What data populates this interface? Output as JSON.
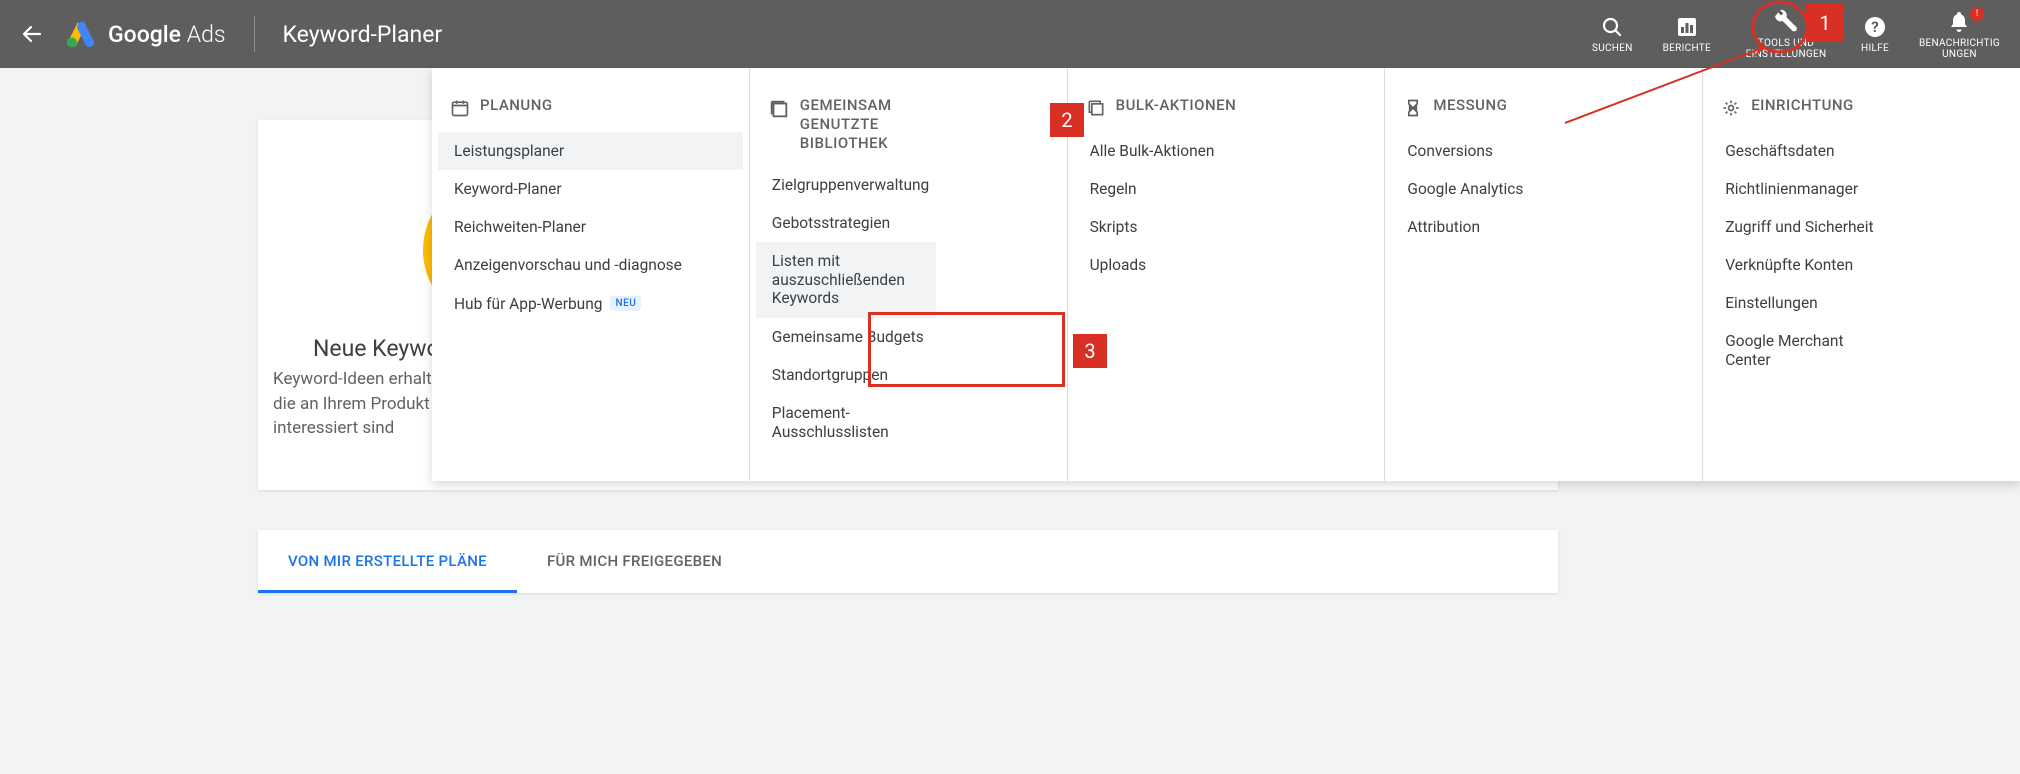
{
  "header": {
    "brand_bold": "Google",
    "brand_light": "Ads",
    "page_title": "Keyword-Planer",
    "tools": {
      "search": "SUCHEN",
      "reports": "BERICHTE",
      "tools_settings": "TOOLS UND EINSTELLUNGEN",
      "help": "HILFE",
      "notifications": "BENACHRICHTIG\nUNGEN"
    }
  },
  "card": {
    "title": "Neue Keywo",
    "description": "Keyword-Ideen erhalten\ndie an Ihrem Produkt od\ninteressiert sind"
  },
  "tabs": {
    "mine": "VON MIR ERSTELLTE PLÄNE",
    "shared": "FÜR MICH FREIGEGEBEN"
  },
  "mega": {
    "planning": {
      "title": "PLANUNG",
      "items": [
        "Leistungsplaner",
        "Keyword-Planer",
        "Reichweiten-Planer",
        "Anzeigenvorschau und -diagnose",
        "Hub für App-Werbung"
      ],
      "new_badge": "NEU"
    },
    "shared_library": {
      "title": "GEMEINSAM GENUTZTE BIBLIOTHEK",
      "items": [
        "Zielgruppenverwaltung",
        "Gebotsstrategien",
        "Listen mit auszuschließenden Keywords",
        "Gemeinsame Budgets",
        "Standortgruppen",
        "Placement-Ausschlusslisten"
      ]
    },
    "bulk": {
      "title": "BULK-AKTIONEN",
      "items": [
        "Alle Bulk-Aktionen",
        "Regeln",
        "Skripts",
        "Uploads"
      ]
    },
    "measurement": {
      "title": "MESSUNG",
      "items": [
        "Conversions",
        "Google Analytics",
        "Attribution"
      ]
    },
    "setup": {
      "title": "EINRICHTUNG",
      "items": [
        "Geschäftsdaten",
        "Richtlinienmanager",
        "Zugriff und Sicherheit",
        "Verknüpfte Konten",
        "Einstellungen",
        "Google Merchant Center"
      ]
    }
  },
  "annotations": {
    "a1": "1",
    "a2": "2",
    "a3": "3"
  }
}
